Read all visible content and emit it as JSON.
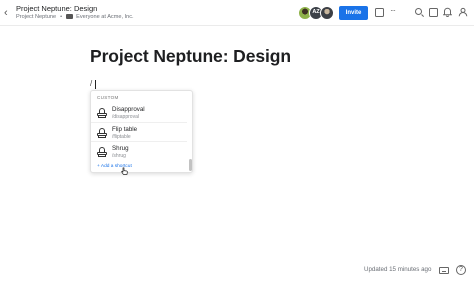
{
  "header": {
    "back_glyph": "‹",
    "doc_title": "Project Neptune: Design",
    "breadcrumb_project": "Project Neptune",
    "breadcrumb_separator": "•",
    "breadcrumb_folder": "Everyone at Acme, Inc.",
    "avatar_initials": "AZ",
    "invite_label": "Invite",
    "more_glyph": "···"
  },
  "document": {
    "title": "Project Neptune: Design",
    "typed_text": "/"
  },
  "shortcut_menu": {
    "section_label": "CUSTOM",
    "items": [
      {
        "name": "Disapproval",
        "command": "/disapproval"
      },
      {
        "name": "Flip table",
        "command": "/fliptable"
      },
      {
        "name": "Shrug",
        "command": "/shrug"
      }
    ],
    "add_label": "+ Add a shortcut"
  },
  "footer": {
    "updated_text": "Updated 15 minutes ago",
    "help_glyph": "?"
  },
  "colors": {
    "accent": "#1a73e8",
    "text": "#1e1f21",
    "muted": "#6b6f76"
  },
  "icons": [
    "chevron-left-icon",
    "folder-icon",
    "comment-icon",
    "search-icon",
    "checklist-icon",
    "bell-icon",
    "bell-shortcut-icon",
    "keyboard-icon",
    "help-icon",
    "pointer-cursor-icon"
  ]
}
